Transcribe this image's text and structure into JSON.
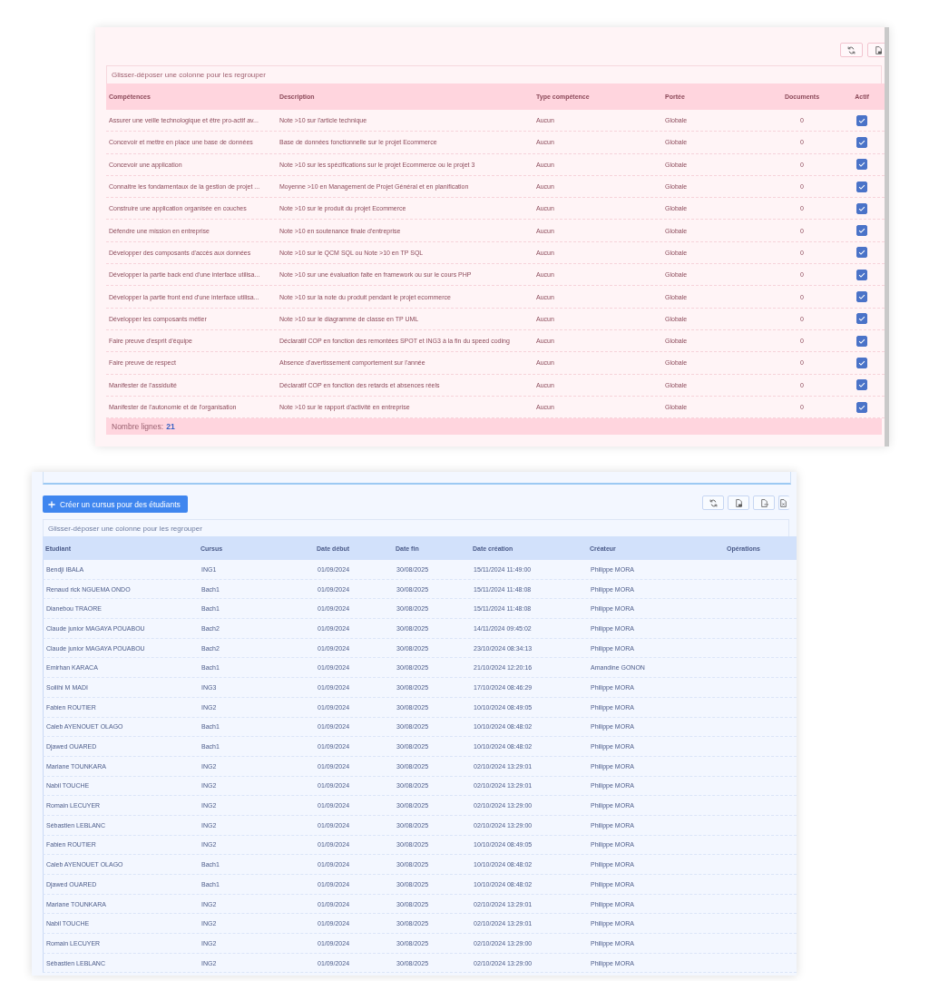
{
  "competences_panel": {
    "toolbar": [
      {
        "kind": "refresh"
      },
      {
        "kind": "pdf"
      }
    ],
    "group_hint": "Glisser-déposer une colonne pour les regrouper",
    "columns": [
      "Compétences",
      "Description",
      "Type compétence",
      "Portée",
      "Documents",
      "Actif"
    ],
    "rows": [
      {
        "competence": "Assurer une veille technologique et être pro-actif av...",
        "description": "Note >10 sur l'article technique",
        "type": "Aucun",
        "portee": "Globale",
        "documents": "0",
        "actif": true
      },
      {
        "competence": "Concevoir et mettre en place une base de données",
        "description": "Base de données fonctionnelle sur le projet Ecommerce",
        "type": "Aucun",
        "portee": "Globale",
        "documents": "0",
        "actif": true
      },
      {
        "competence": "Concevoir une application",
        "description": "Note >10 sur les spécifications sur le projet Ecommerce ou le projet 3",
        "type": "Aucun",
        "portee": "Globale",
        "documents": "0",
        "actif": true
      },
      {
        "competence": "Connaitre les fondamentaux de la gestion de projet ...",
        "description": "Moyenne >10 en Management de Projet Général et en planification",
        "type": "Aucun",
        "portee": "Globale",
        "documents": "0",
        "actif": true
      },
      {
        "competence": "Construire une application organisée en couches",
        "description": "Note >10 sur le produit du projet Ecommerce",
        "type": "Aucun",
        "portee": "Globale",
        "documents": "0",
        "actif": true
      },
      {
        "competence": "Défendre une mission en entreprise",
        "description": "Note >10 en soutenance finale d'entreprise",
        "type": "Aucun",
        "portee": "Globale",
        "documents": "0",
        "actif": true
      },
      {
        "competence": "Développer des composants d'accès aux données",
        "description": "Note >10 sur le QCM SQL ou Note >10 en TP SQL",
        "type": "Aucun",
        "portee": "Globale",
        "documents": "0",
        "actif": true
      },
      {
        "competence": "Développer la partie back end d'une interface utilisa...",
        "description": "Note >10 sur une évaluation faite en framework ou sur le cours PHP",
        "type": "Aucun",
        "portee": "Globale",
        "documents": "0",
        "actif": true
      },
      {
        "competence": "Développer la partie front end d'une interface utilisa...",
        "description": "Note >10 sur la note du produit pendant le projet ecommerce",
        "type": "Aucun",
        "portee": "Globale",
        "documents": "0",
        "actif": true
      },
      {
        "competence": "Développer les composants métier",
        "description": "Note >10 sur le diagramme de classe en TP UML",
        "type": "Aucun",
        "portee": "Globale",
        "documents": "0",
        "actif": true
      },
      {
        "competence": "Faire preuve d'esprit d'équipe",
        "description": "Déclaratif COP en fonction des remontées SPOT et ING3 à la fin du speed coding",
        "type": "Aucun",
        "portee": "Globale",
        "documents": "0",
        "actif": true
      },
      {
        "competence": "Faire preuve de respect",
        "description": "Absence d'avertissement comportement sur l'année",
        "type": "Aucun",
        "portee": "Globale",
        "documents": "0",
        "actif": true
      },
      {
        "competence": "Manifester de l'assiduité",
        "description": "Déclaratif COP en fonction des retards et absences réels",
        "type": "Aucun",
        "portee": "Globale",
        "documents": "0",
        "actif": true
      },
      {
        "competence": "Manifester de l'autonomie et de l'organisation",
        "description": "Note >10 sur le rapport d'activité en entreprise",
        "type": "Aucun",
        "portee": "Globale",
        "documents": "0",
        "actif": true
      }
    ],
    "footer": {
      "label": "Nombre lignes:",
      "count": "21"
    }
  },
  "cursus_panel": {
    "create_button": "Créer un cursus pour des étudiants",
    "toolbar": [
      {
        "kind": "refresh"
      },
      {
        "kind": "pdf"
      },
      {
        "kind": "export"
      },
      {
        "kind": "excel"
      }
    ],
    "group_hint": "Glisser-déposer une colonne pour les regrouper",
    "columns": [
      "Etudiant",
      "Cursus",
      "Date début",
      "Date fin",
      "Date création",
      "Créateur",
      "Opérations"
    ],
    "rows": [
      {
        "etudiant": "Bendji IBALA",
        "cursus": "ING1",
        "date_debut": "01/09/2024",
        "date_fin": "30/08/2025",
        "date_creation": "15/11/2024 11:49:00",
        "createur": "Philippe MORA"
      },
      {
        "etudiant": "Renaud rick NGUEMA ONDO",
        "cursus": "Bach1",
        "date_debut": "01/09/2024",
        "date_fin": "30/08/2025",
        "date_creation": "15/11/2024 11:48:08",
        "createur": "Philippe MORA"
      },
      {
        "etudiant": "Dianebou TRAORE",
        "cursus": "Bach1",
        "date_debut": "01/09/2024",
        "date_fin": "30/08/2025",
        "date_creation": "15/11/2024 11:48:08",
        "createur": "Philippe MORA"
      },
      {
        "etudiant": "Claude junior MAGAYA POUABOU",
        "cursus": "Bach2",
        "date_debut": "01/09/2024",
        "date_fin": "30/08/2025",
        "date_creation": "14/11/2024 09:45:02",
        "createur": "Philippe MORA"
      },
      {
        "etudiant": "Claude junior MAGAYA POUABOU",
        "cursus": "Bach2",
        "date_debut": "01/09/2024",
        "date_fin": "30/08/2025",
        "date_creation": "23/10/2024 08:34:13",
        "createur": "Philippe MORA"
      },
      {
        "etudiant": "Emirhan KARACA",
        "cursus": "Bach1",
        "date_debut": "01/09/2024",
        "date_fin": "30/08/2025",
        "date_creation": "21/10/2024 12:20:16",
        "createur": "Amandine GONON"
      },
      {
        "etudiant": "Soilihi M MADI",
        "cursus": "ING3",
        "date_debut": "01/09/2024",
        "date_fin": "30/08/2025",
        "date_creation": "17/10/2024 08:46:29",
        "createur": "Philippe MORA"
      },
      {
        "etudiant": "Fabien ROUTIER",
        "cursus": "ING2",
        "date_debut": "01/09/2024",
        "date_fin": "30/08/2025",
        "date_creation": "10/10/2024 08:49:05",
        "createur": "Philippe MORA"
      },
      {
        "etudiant": "Caleb AYENOUET OLAGO",
        "cursus": "Bach1",
        "date_debut": "01/09/2024",
        "date_fin": "30/08/2025",
        "date_creation": "10/10/2024 08:48:02",
        "createur": "Philippe MORA"
      },
      {
        "etudiant": "Djawed OUARED",
        "cursus": "Bach1",
        "date_debut": "01/09/2024",
        "date_fin": "30/08/2025",
        "date_creation": "10/10/2024 08:48:02",
        "createur": "Philippe MORA"
      },
      {
        "etudiant": "Mariane TOUNKARA",
        "cursus": "ING2",
        "date_debut": "01/09/2024",
        "date_fin": "30/08/2025",
        "date_creation": "02/10/2024 13:29:01",
        "createur": "Philippe MORA"
      },
      {
        "etudiant": "Nabil TOUCHE",
        "cursus": "ING2",
        "date_debut": "01/09/2024",
        "date_fin": "30/08/2025",
        "date_creation": "02/10/2024 13:29:01",
        "createur": "Philippe MORA"
      },
      {
        "etudiant": "Romain LECUYER",
        "cursus": "ING2",
        "date_debut": "01/09/2024",
        "date_fin": "30/08/2025",
        "date_creation": "02/10/2024 13:29:00",
        "createur": "Philippe MORA"
      },
      {
        "etudiant": "Sébastien LEBLANC",
        "cursus": "ING2",
        "date_debut": "01/09/2024",
        "date_fin": "30/08/2025",
        "date_creation": "02/10/2024 13:29:00",
        "createur": "Philippe MORA"
      },
      {
        "etudiant": "Fabien ROUTIER",
        "cursus": "ING2",
        "date_debut": "01/09/2024",
        "date_fin": "30/08/2025",
        "date_creation": "10/10/2024 08:49:05",
        "createur": "Philippe MORA"
      },
      {
        "etudiant": "Caleb AYENOUET OLAGO",
        "cursus": "Bach1",
        "date_debut": "01/09/2024",
        "date_fin": "30/08/2025",
        "date_creation": "10/10/2024 08:48:02",
        "createur": "Philippe MORA"
      },
      {
        "etudiant": "Djawed OUARED",
        "cursus": "Bach1",
        "date_debut": "01/09/2024",
        "date_fin": "30/08/2025",
        "date_creation": "10/10/2024 08:48:02",
        "createur": "Philippe MORA"
      },
      {
        "etudiant": "Mariane TOUNKARA",
        "cursus": "ING2",
        "date_debut": "01/09/2024",
        "date_fin": "30/08/2025",
        "date_creation": "02/10/2024 13:29:01",
        "createur": "Philippe MORA"
      },
      {
        "etudiant": "Nabil TOUCHE",
        "cursus": "ING2",
        "date_debut": "01/09/2024",
        "date_fin": "30/08/2025",
        "date_creation": "02/10/2024 13:29:01",
        "createur": "Philippe MORA"
      },
      {
        "etudiant": "Romain LECUYER",
        "cursus": "ING2",
        "date_debut": "01/09/2024",
        "date_fin": "30/08/2025",
        "date_creation": "02/10/2024 13:29:00",
        "createur": "Philippe MORA"
      },
      {
        "etudiant": "Sébastien LEBLANC",
        "cursus": "ING2",
        "date_debut": "01/09/2024",
        "date_fin": "30/08/2025",
        "date_creation": "02/10/2024 13:29:00",
        "createur": "Philippe MORA"
      }
    ]
  }
}
